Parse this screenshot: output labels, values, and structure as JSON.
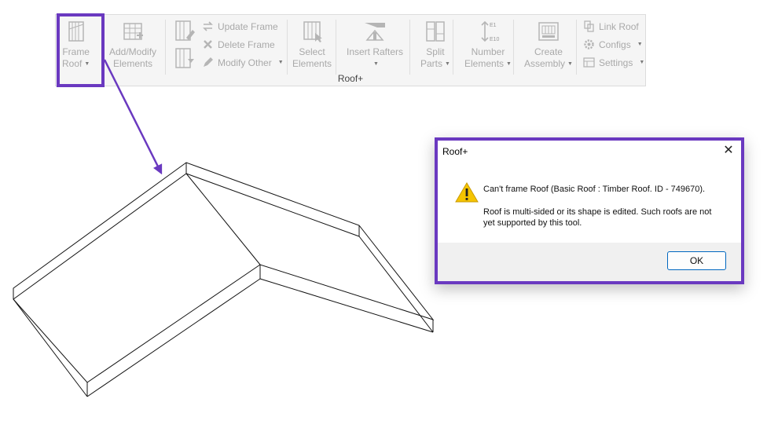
{
  "ribbon": {
    "group_label": "Roof+",
    "frame_roof": "Frame Roof",
    "frame_roof_line1": "Frame",
    "frame_roof_line2": "Roof",
    "add_modify_line1": "Add/Modify",
    "add_modify_line2": "Elements",
    "update_frame": "Update Frame",
    "delete_frame": "Delete Frame",
    "modify_other": "Modify Other",
    "select_line1": "Select",
    "select_line2": "Elements",
    "insert_rafters": "Insert Rafters",
    "split_line1": "Split",
    "split_line2": "Parts",
    "number_line1": "Number",
    "number_line2": "Elements",
    "number_icon_top": "E1",
    "number_icon_bottom": "E10",
    "create_line1": "Create",
    "create_line2": "Assembly",
    "link_roof": "Link Roof",
    "configs": "Configs",
    "settings": "Settings"
  },
  "dialog": {
    "title": "Roof+",
    "close_glyph": "✕",
    "message_line1": "Can't frame Roof (Basic Roof : Timber Roof. ID - 749670).",
    "message_line2": "Roof is multi-sided or its shape is edited. Such roofs are not yet supported by this tool.",
    "ok_label": "OK"
  },
  "colors": {
    "highlight": "#6a39c0",
    "disabled_text": "#a9a9a9",
    "ok_border": "#0067c0",
    "warning": "#f5c400"
  },
  "icons": [
    "frame-roof-icon",
    "add-modify-icon",
    "update-frame-icon",
    "delete-frame-icon",
    "modify-other-icon",
    "select-elements-icon",
    "insert-rafters-icon",
    "split-parts-icon",
    "number-elements-icon",
    "create-assembly-icon",
    "link-roof-icon",
    "configs-icon",
    "settings-icon",
    "warning-icon",
    "close-icon"
  ]
}
